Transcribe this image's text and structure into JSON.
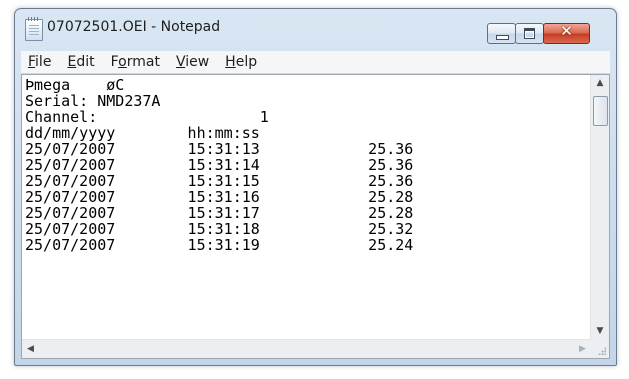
{
  "window": {
    "title": "07072501.OEI - Notepad",
    "controls": {
      "minimize": "minimize",
      "maximize": "maximize",
      "close": "✕"
    }
  },
  "menu": [
    {
      "accel": "F",
      "rest": "ile"
    },
    {
      "accel": "E",
      "rest": "dit"
    },
    {
      "pre": "F",
      "accel": "o",
      "rest": "rmat"
    },
    {
      "accel": "V",
      "rest": "iew"
    },
    {
      "accel": "H",
      "rest": "elp"
    }
  ],
  "document": {
    "lines": [
      "Þmega    øC",
      "Serial: NMD237A",
      "Channel:                  1",
      "dd/mm/yyyy        hh:mm:ss",
      "25/07/2007        15:31:13            25.36",
      "25/07/2007        15:31:14            25.36",
      "25/07/2007        15:31:15            25.36",
      "25/07/2007        15:31:16            25.28",
      "25/07/2007        15:31:17            25.28",
      "25/07/2007        15:31:18            25.32",
      "25/07/2007        15:31:19            25.24"
    ]
  },
  "scrollbar": {
    "up_arrow": "▲",
    "down_arrow": "▼",
    "left_arrow": "◀",
    "right_arrow": "▶"
  },
  "colors": {
    "close_button": "#c43c22",
    "title_bar": "#c3d5e8"
  }
}
